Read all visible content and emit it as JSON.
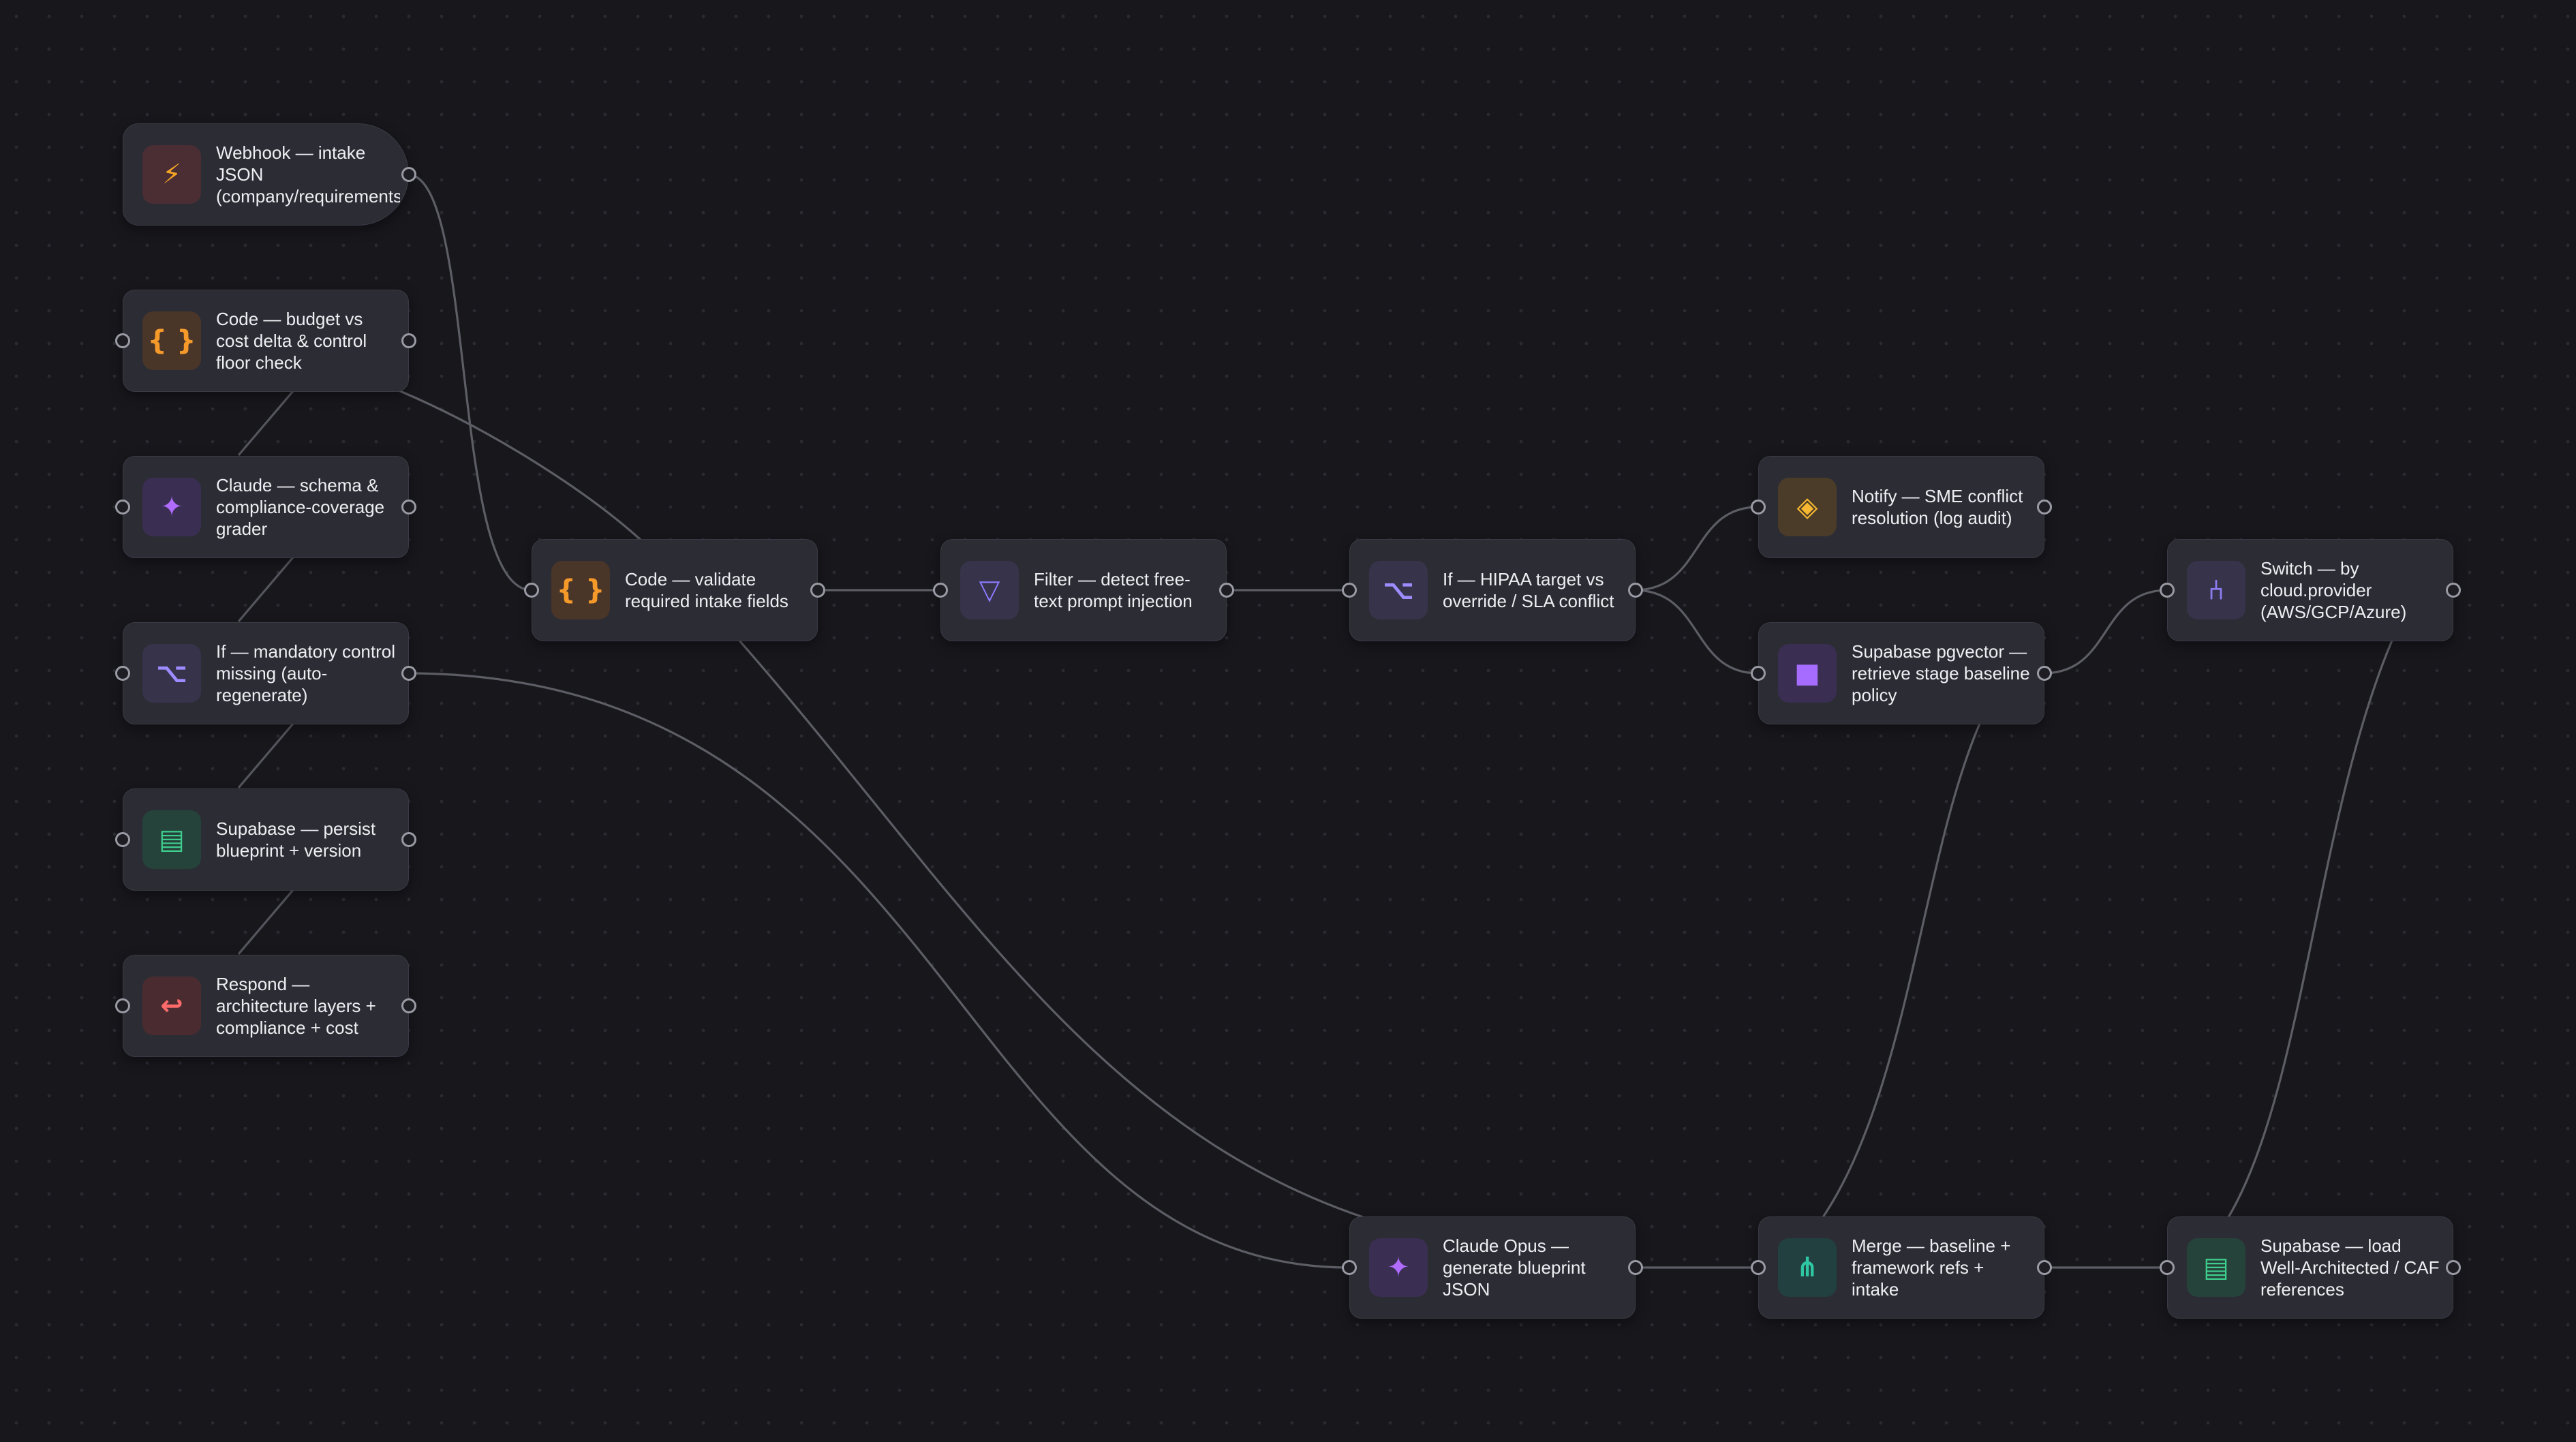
{
  "workflow": {
    "nodes": [
      {
        "id": "webhook",
        "label": "Webhook — intake JSON (company/requirements)",
        "icon": "lightning-icon",
        "glyph": "⚡"
      },
      {
        "id": "code_budget",
        "label": "Code — budget vs cost delta & control floor check",
        "icon": "code-braces-icon",
        "glyph": "{ }"
      },
      {
        "id": "claude_grader",
        "label": "Claude — schema & compliance-coverage grader",
        "icon": "sparkle-icon",
        "glyph": "✦"
      },
      {
        "id": "if_mandatory",
        "label": "If — mandatory control missing (auto-regenerate)",
        "icon": "branch-icon",
        "glyph": "⌥"
      },
      {
        "id": "supa_persist",
        "label": "Supabase — persist blueprint + version",
        "icon": "database-table-icon",
        "glyph": "▤"
      },
      {
        "id": "respond",
        "label": "Respond — architecture layers + compliance + cost",
        "icon": "return-arrow-icon",
        "glyph": "↩"
      },
      {
        "id": "code_validate",
        "label": "Code — validate required intake fields",
        "icon": "code-braces-icon",
        "glyph": "{ }"
      },
      {
        "id": "filter",
        "label": "Filter — detect free-text prompt injection",
        "icon": "filter-icon",
        "glyph": "▽"
      },
      {
        "id": "if_hipaa",
        "label": "If — HIPAA target vs override / SLA conflict",
        "icon": "branch-icon",
        "glyph": "⌥"
      },
      {
        "id": "notify",
        "label": "Notify — SME conflict resolution (log audit)",
        "icon": "diamond-icon",
        "glyph": "◈"
      },
      {
        "id": "pgvector",
        "label": "Supabase pgvector — retrieve stage baseline policy",
        "icon": "vector-square-icon",
        "glyph": "■"
      },
      {
        "id": "switch",
        "label": "Switch — by cloud.provider (AWS/GCP/Azure)",
        "icon": "switch-fork-icon",
        "glyph": "⑃"
      },
      {
        "id": "claude_opus",
        "label": "Claude Opus — generate blueprint JSON",
        "icon": "sparkle-icon",
        "glyph": "✦"
      },
      {
        "id": "merge",
        "label": "Merge — baseline + framework refs + intake",
        "icon": "merge-icon",
        "glyph": "⋔"
      },
      {
        "id": "supa_load",
        "label": "Supabase — load Well-Architected / CAF references",
        "icon": "database-table-icon",
        "glyph": "▤"
      }
    ]
  }
}
